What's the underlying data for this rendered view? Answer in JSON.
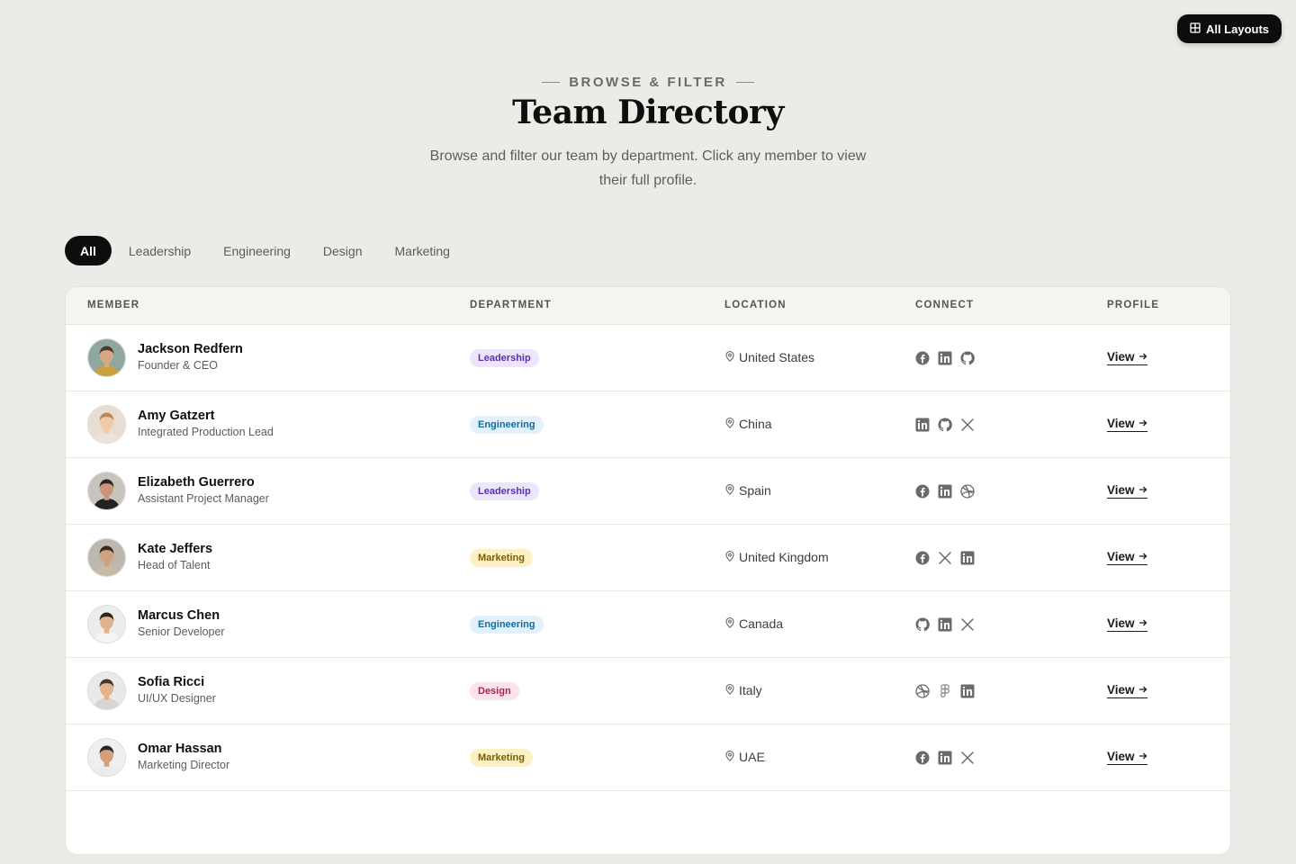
{
  "top_button": {
    "label": "All Layouts",
    "icon": "grid-icon"
  },
  "hero": {
    "eyebrow": "BROWSE & FILTER",
    "title": "Team Directory",
    "subtitle": "Browse and filter our team by department. Click any member to view their full profile."
  },
  "filters": [
    "All",
    "Leadership",
    "Engineering",
    "Design",
    "Marketing"
  ],
  "active_filter": "All",
  "table": {
    "headers": [
      "MEMBER",
      "DEPARTMENT",
      "LOCATION",
      "CONNECT",
      "PROFILE"
    ],
    "rows": [
      {
        "name": "Jackson Redfern",
        "role": "Founder & CEO",
        "department": "Leadership",
        "location": "United States",
        "socials": [
          "facebook-icon",
          "linkedin-icon",
          "github-icon"
        ],
        "action": "View"
      },
      {
        "name": "Amy Gatzert",
        "role": "Integrated Production Lead",
        "department": "Engineering",
        "location": "China",
        "socials": [
          "linkedin-icon",
          "github-icon",
          "x-icon"
        ],
        "action": "View"
      },
      {
        "name": "Elizabeth Guerrero",
        "role": "Assistant Project Manager",
        "department": "Leadership",
        "location": "Spain",
        "socials": [
          "facebook-icon",
          "linkedin-icon",
          "dribbble-icon"
        ],
        "action": "View"
      },
      {
        "name": "Kate Jeffers",
        "role": "Head of Talent",
        "department": "Marketing",
        "location": "United Kingdom",
        "socials": [
          "facebook-icon",
          "x-icon",
          "linkedin-icon"
        ],
        "action": "View"
      },
      {
        "name": "Marcus Chen",
        "role": "Senior Developer",
        "department": "Engineering",
        "location": "Canada",
        "socials": [
          "github-icon",
          "linkedin-icon",
          "x-icon"
        ],
        "action": "View"
      },
      {
        "name": "Sofia Ricci",
        "role": "UI/UX Designer",
        "department": "Design",
        "location": "Italy",
        "socials": [
          "dribbble-icon",
          "figma-icon",
          "linkedin-icon"
        ],
        "action": "View"
      },
      {
        "name": "Omar Hassan",
        "role": "Marketing Director",
        "department": "Marketing",
        "location": "UAE",
        "socials": [
          "facebook-icon",
          "linkedin-icon",
          "x-icon"
        ],
        "action": "View"
      }
    ]
  },
  "colors": {
    "page_bg": "#edebe7",
    "primary_dark": "#0d0d0d",
    "leadership": "#5b2fb3",
    "engineering": "#146d9c",
    "marketing": "#7a5c08",
    "design": "#a3274f"
  }
}
